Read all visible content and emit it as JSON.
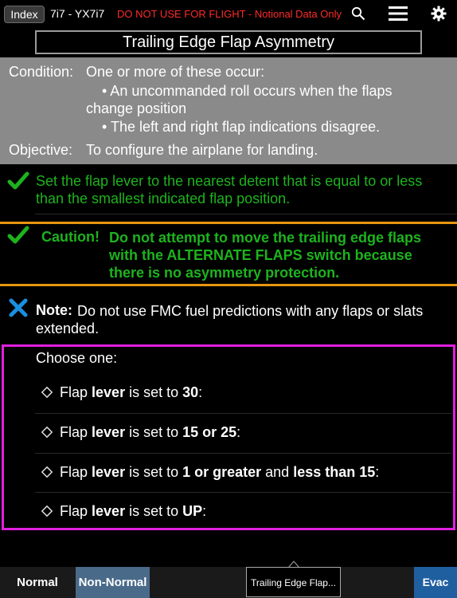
{
  "topbar": {
    "index_label": "Index",
    "tail": "7i7 - YX7i7",
    "warning": "DO NOT USE FOR FLIGHT - Notional Data Only",
    "icons": [
      "search-icon",
      "menu-icon",
      "gear-icon"
    ]
  },
  "title": "Trailing Edge Flap Asymmetry",
  "condition": {
    "label": "Condition:",
    "text": "One or more of these occur:",
    "bullets": [
      "• An uncommanded roll occurs when the flaps change position",
      "• The left and right flap indications disagree."
    ]
  },
  "objective": {
    "label": "Objective:",
    "text": "To configure the airplane for landing."
  },
  "steps": {
    "step1": "Set the flap lever to the nearest detent that is equal to or less than the smallest indicated flap position.",
    "caution_label": "Caution!",
    "caution_text": "Do not attempt to move the trailing edge flaps with the ALTERNATE FLAPS switch because there is no asymmetry protection.",
    "note_label": "Note:",
    "note_text": "Do not use FMC fuel predictions with any flaps or slats extended."
  },
  "choose": {
    "label": "Choose one:",
    "options": [
      {
        "pre": "Flap ",
        "b1": "lever",
        "mid": " is set to ",
        "b2": "30",
        "mid2": "",
        "b3": "",
        "post": ":"
      },
      {
        "pre": "Flap ",
        "b1": "lever",
        "mid": " is set to ",
        "b2": "15 or 25",
        "mid2": "",
        "b3": "",
        "post": ":"
      },
      {
        "pre": "Flap ",
        "b1": "lever",
        "mid": " is set to ",
        "b2": "1 or greater",
        "mid2": " and ",
        "b3": "less than 15",
        "post": ":"
      },
      {
        "pre": "Flap ",
        "b1": "lever",
        "mid": " is set to ",
        "b2": "UP",
        "mid2": "",
        "b3": "",
        "post": ":"
      }
    ]
  },
  "bottombar": {
    "normal": "Normal",
    "non_normal": "Non-Normal",
    "current": "Trailing Edge Flap...",
    "evac": "Evac"
  },
  "colors": {
    "accent_green": "#1db31d",
    "caution_orange": "#e8960e",
    "choose_magenta": "#e020e0",
    "warning_red": "#ff2a2a",
    "note_blue": "#1a8fe0"
  }
}
